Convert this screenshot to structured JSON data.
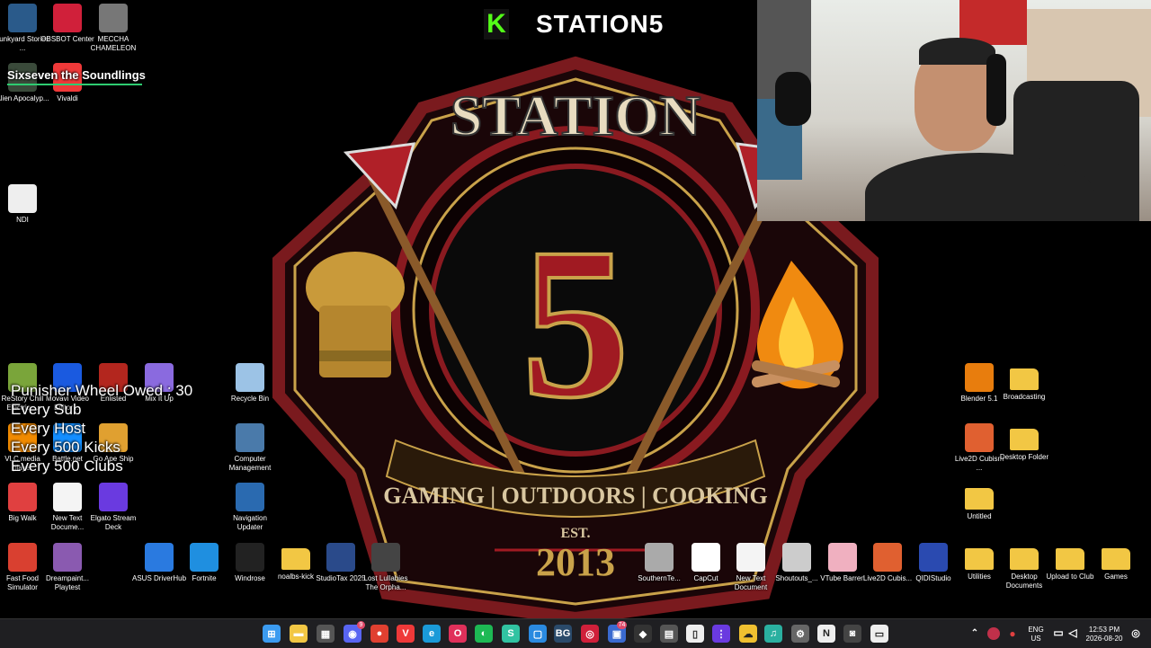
{
  "stream": {
    "channel_name": "STATION5",
    "brand_letter": "K",
    "alert_text": "Sixseven the Soundlings",
    "wheel": {
      "title": "Punisher Wheel Owed : 30",
      "lines": [
        "Every Sub",
        "Every Host",
        "Every 500 Kicks",
        "Every 500 Clubs"
      ]
    }
  },
  "emblem": {
    "top_text": "STATION",
    "number": "5",
    "banner": "GAMING | OUTDOORS | COOKING",
    "est": "EST.",
    "year": "2013"
  },
  "desktop_icons": [
    {
      "label": "Junkyard Stories ...",
      "icon": "game-icon",
      "color": "#2a5a8a"
    },
    {
      "label": "OBSBOT Center",
      "icon": "obsbot-icon",
      "color": "#d0203a"
    },
    {
      "label": "MECCHA CHAMELEON",
      "icon": "chameleon-icon",
      "color": "#777"
    },
    {
      "label": "Alien Apocalyp...",
      "icon": "alien-icon",
      "color": "#3a4a3a"
    },
    {
      "label": "Vivaldi",
      "icon": "vivaldi-icon",
      "color": "#ef3939"
    },
    {
      "label": "NDI",
      "icon": "ndi-icon",
      "color": "#eee"
    },
    {
      "label": "ReStory Chill Electric ...",
      "icon": "restory-icon",
      "color": "#7aa53a"
    },
    {
      "label": "Movavi Video Editor ...",
      "icon": "movavi-icon",
      "color": "#1a5ae0"
    },
    {
      "label": "Enlisted",
      "icon": "enlisted-icon",
      "color": "#b3261e"
    },
    {
      "label": "Mix It Up",
      "icon": "mixitup-icon",
      "color": "#8a6adf"
    },
    {
      "label": "Recycle Bin",
      "icon": "recycle-bin-icon",
      "color": "#9cc3e6"
    },
    {
      "label": "VLC media player",
      "icon": "vlc-icon",
      "color": "#f08a00"
    },
    {
      "label": "Battle.net",
      "icon": "battlenet-icon",
      "color": "#148eff"
    },
    {
      "label": "Go Ape Ship",
      "icon": "goapeship-icon",
      "color": "#e0a030"
    },
    {
      "label": "Computer Management",
      "icon": "computer-management-icon",
      "color": "#4a7aaa"
    },
    {
      "label": "Big Walk",
      "icon": "bigwalk-icon",
      "color": "#e04040"
    },
    {
      "label": "New Text Docume...",
      "icon": "text-document-icon",
      "color": "#f4f4f4"
    },
    {
      "label": "Elgato Stream Deck",
      "icon": "streamdeck-icon",
      "color": "#6a3ae0"
    },
    {
      "label": "Navigation Updater",
      "icon": "navigation-icon",
      "color": "#2a6ab0"
    },
    {
      "label": "Blender 5.1",
      "icon": "blender-icon",
      "color": "#e87d0d"
    },
    {
      "label": "Broadcasting",
      "icon": "folder-icon",
      "color": "#f2c744"
    },
    {
      "label": "Live2D Cubism ...",
      "icon": "live2d-icon",
      "color": "#e06030"
    },
    {
      "label": "Desktop Folder",
      "icon": "folder-icon",
      "color": "#f2c744"
    },
    {
      "label": "Untitled",
      "icon": "folder-icon",
      "color": "#f2c744"
    },
    {
      "label": "Fast Food Simulator",
      "icon": "fastfood-icon",
      "color": "#d94030"
    },
    {
      "label": "Dreampaint... Playtest",
      "icon": "dreampaint-icon",
      "color": "#8a5ab0"
    },
    {
      "label": "ASUS DriverHub",
      "icon": "asus-icon",
      "color": "#2a7ae0"
    },
    {
      "label": "Fortnite",
      "icon": "fortnite-icon",
      "color": "#1f8fe0"
    },
    {
      "label": "Windrose",
      "icon": "windrose-icon",
      "color": "#222"
    },
    {
      "label": "noalbs-kick",
      "icon": "folder-icon",
      "color": "#f2c744"
    },
    {
      "label": "StudioTax 2025",
      "icon": "studiotax-icon",
      "color": "#2a4a8a"
    },
    {
      "label": "Lost Lullabies The Orpha...",
      "icon": "lostlullabies-icon",
      "color": "#444"
    },
    {
      "label": "SouthernTe...",
      "icon": "southern-icon",
      "color": "#aaa"
    },
    {
      "label": "CapCut",
      "icon": "capcut-icon",
      "color": "#fff"
    },
    {
      "label": "New Text Document",
      "icon": "text-document-icon",
      "color": "#f4f4f4"
    },
    {
      "label": "Shoutouts_...",
      "icon": "shoutouts-icon",
      "color": "#ccc"
    },
    {
      "label": "VTube Barren",
      "icon": "vtube-icon",
      "color": "#f0b0c0"
    },
    {
      "label": "Live2D Cubis...",
      "icon": "live2d-icon",
      "color": "#e06030"
    },
    {
      "label": "QIDIStudio",
      "icon": "qidi-icon",
      "color": "#2a4ab0"
    },
    {
      "label": "Utilities",
      "icon": "folder-icon",
      "color": "#f2c744"
    },
    {
      "label": "Desktop Documents",
      "icon": "folder-icon",
      "color": "#f2c744"
    },
    {
      "label": "Upload to Club",
      "icon": "folder-icon",
      "color": "#f2c744"
    },
    {
      "label": "Games",
      "icon": "folder-icon",
      "color": "#f2c744"
    }
  ],
  "taskbar": {
    "apps": [
      {
        "icon": "windows-start-icon",
        "color": "#3b9bf0",
        "glyph": "⊞"
      },
      {
        "icon": "file-explorer-icon",
        "color": "#f2c744",
        "glyph": "▬"
      },
      {
        "icon": "store-icon",
        "color": "#555",
        "glyph": "▦"
      },
      {
        "icon": "discord-icon",
        "color": "#5865f2",
        "glyph": "◉"
      },
      {
        "icon": "chrome-icon",
        "color": "#e04030",
        "glyph": "●"
      },
      {
        "icon": "vivaldi-icon",
        "color": "#ef3939",
        "glyph": "V"
      },
      {
        "icon": "edge-icon",
        "color": "#1a9ad8",
        "glyph": "e"
      },
      {
        "icon": "opera-icon",
        "color": "#e0305a",
        "glyph": "O"
      },
      {
        "icon": "spotify-icon",
        "color": "#1db954",
        "glyph": "◐"
      },
      {
        "icon": "streamlabs-icon",
        "color": "#31c3a2",
        "glyph": "S"
      },
      {
        "icon": "sandbox-icon",
        "color": "#2a8ae0",
        "glyph": "▢"
      },
      {
        "icon": "bg-icon",
        "color": "#2a4a6a",
        "glyph": "BG"
      },
      {
        "icon": "obsbot-icon",
        "color": "#d0203a",
        "glyph": "◎"
      },
      {
        "icon": "phone-link-icon",
        "color": "#3a6ad0",
        "glyph": "▣"
      },
      {
        "icon": "nvidia-icon",
        "color": "#333",
        "glyph": "◆"
      },
      {
        "icon": "calculator-icon",
        "color": "#555",
        "glyph": "▤"
      },
      {
        "icon": "notepad-icon",
        "color": "#eee",
        "glyph": "▯"
      },
      {
        "icon": "streamdeck-icon",
        "color": "#6a3ae0",
        "glyph": "⋮"
      },
      {
        "icon": "weather-icon",
        "color": "#f0c030",
        "glyph": "☁"
      },
      {
        "icon": "audio-icon",
        "color": "#2ab0a0",
        "glyph": "♫"
      },
      {
        "icon": "settings-icon",
        "color": "#666",
        "glyph": "⚙"
      },
      {
        "icon": "ndi-tray-icon",
        "color": "#eee",
        "glyph": "N"
      },
      {
        "icon": "obs-icon",
        "color": "#444",
        "glyph": "◙"
      },
      {
        "icon": "notes-icon",
        "color": "#eee",
        "glyph": "▭"
      }
    ],
    "badge_discord": "9",
    "badge_phone": "74",
    "lang_top": "ENG",
    "lang_bottom": "US",
    "time": "12:53 PM",
    "date": "2026-08-20"
  }
}
